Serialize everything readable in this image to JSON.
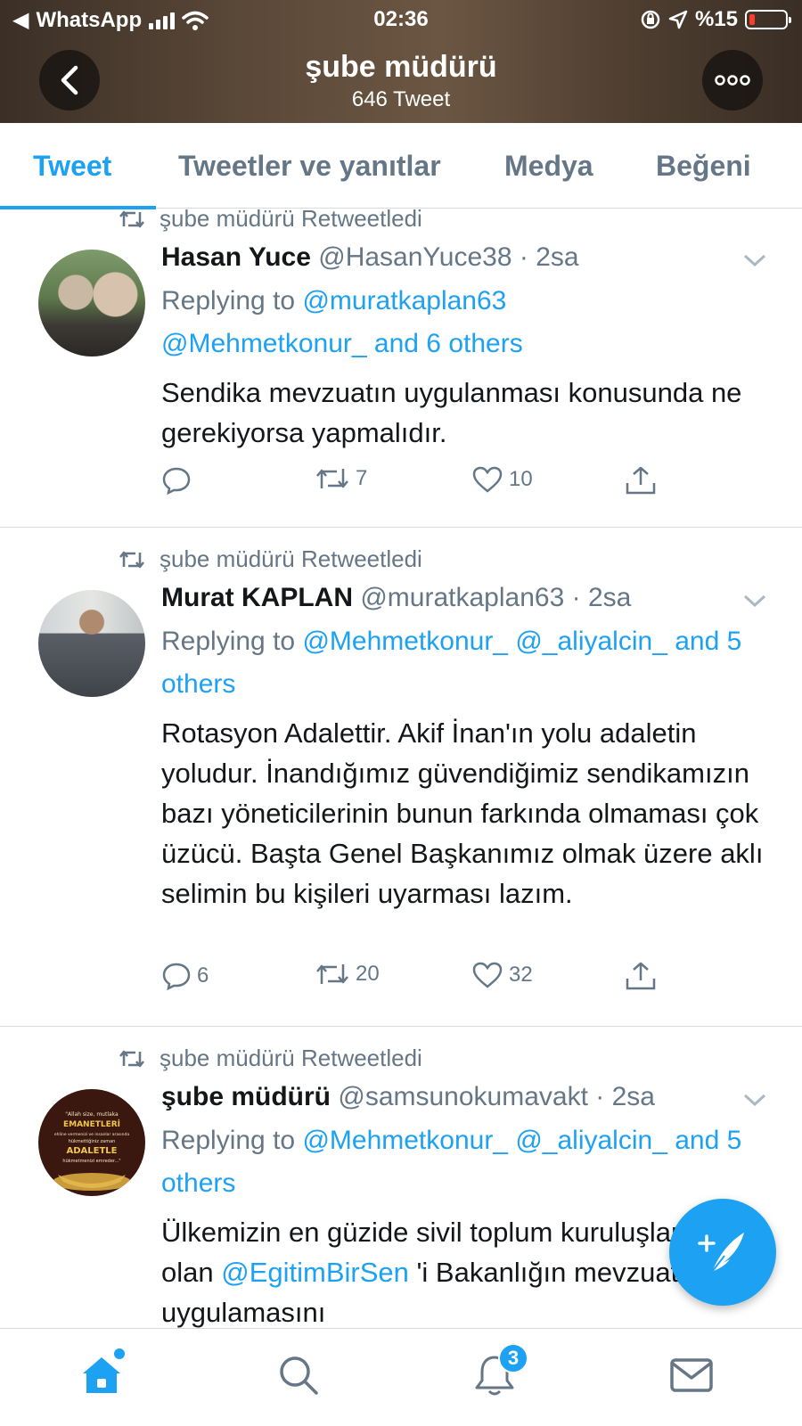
{
  "status_bar": {
    "back_app": "WhatsApp",
    "time": "02:36",
    "battery": "%15"
  },
  "header": {
    "title": "şube müdürü",
    "subtitle": "646 Tweet"
  },
  "tabs": [
    {
      "label": "Tweet",
      "active": true
    },
    {
      "label": "Tweetler ve yanıtlar",
      "active": false
    },
    {
      "label": "Medya",
      "active": false
    },
    {
      "label": "Beğeni",
      "active": false
    }
  ],
  "tweets": [
    {
      "retweeted_by": "şube müdürü Retweetledi",
      "name": "Hasan Yuce",
      "handle": "@HasanYuce38",
      "sep": "·",
      "time": "2sa",
      "replying_prefix": "Replying to",
      "replying_to_1": "@muratkaplan63",
      "replying_to_2": "@Mehmetkonur_",
      "replying_others": "and 6 others",
      "text": "Sendika mevzuatın uygulanması konusunda ne gerekiyorsa yapmalıdır.",
      "replies": "",
      "retweets": "7",
      "likes": "10"
    },
    {
      "retweeted_by": "şube müdürü Retweetledi",
      "name": "Murat KAPLAN",
      "handle": "@muratkaplan63",
      "sep": "·",
      "time": "2sa",
      "replying_prefix": "Replying to",
      "replying_to_1": "@Mehmetkonur_",
      "replying_to_2": "@_aliyalcin_",
      "replying_others": "and 5 others",
      "text": "Rotasyon Adalettir. Akif İnan'ın yolu adaletin yoludur. İnandığımız güvendiğimiz sendikamızın bazı yöneticilerinin bunun farkında olmaması çok üzücü. Başta Genel Başkanımız olmak üzere aklı selimin bu kişileri uyarması lazım.",
      "replies": "6",
      "retweets": "20",
      "likes": "32"
    },
    {
      "retweeted_by": "şube müdürü Retweetledi",
      "name": "şube müdürü",
      "handle": "@samsunokumavakt",
      "sep": "·",
      "time": "2sa",
      "replying_prefix": "Replying to",
      "replying_to_1": "@Mehmetkonur_",
      "replying_to_2": "@_aliyalcin_",
      "replying_others": "and 5 others",
      "text_before": "Ülkemizin en güzide sivil toplum kuruluşlarından olan ",
      "text_mention": "@EgitimBirSen",
      "text_after": " 'i Bakanlığın mevzuat gereği uygulamasını",
      "avatar_text": {
        "line1": "\"Allah size, mutlaka",
        "line2": "EMANETLERİ",
        "line3": "ehline vermenizi ve insanlar arasında",
        "line4": "hükmettiğiniz zaman",
        "line5": "ADALETLE",
        "line6": "hükmetmenizi emreder...\""
      }
    }
  ],
  "bottom_nav": {
    "notifications_badge": "3"
  },
  "icons": {
    "back": "back-arrow-icon",
    "more": "more-dots-icon",
    "retweet": "retweet-icon",
    "reply": "reply-icon",
    "like": "heart-icon",
    "share": "share-icon",
    "compose": "compose-tweet-icon",
    "home": "home-icon",
    "search": "search-icon",
    "notifications": "bell-icon",
    "messages": "mail-icon"
  },
  "colors": {
    "accent": "#1da1f2",
    "secondary_text": "#657786",
    "primary_text": "#14171a"
  }
}
